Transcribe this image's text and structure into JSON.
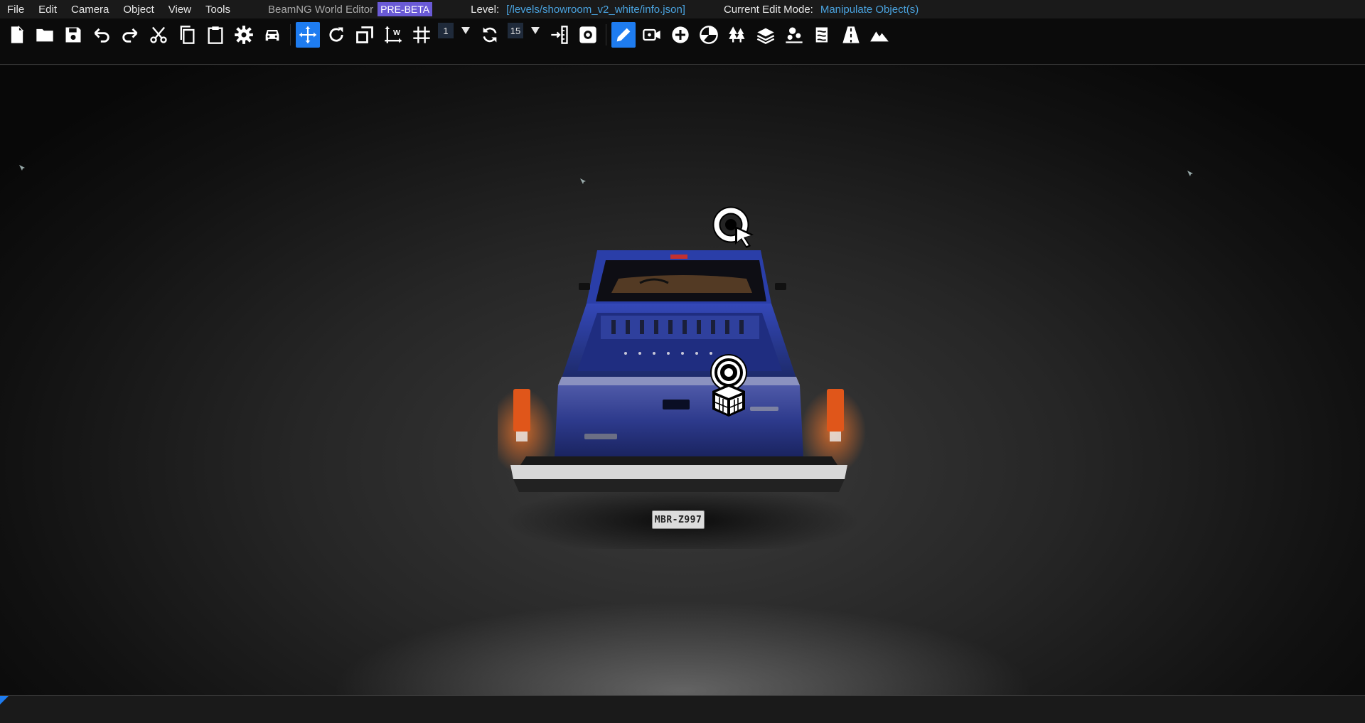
{
  "menu": {
    "items": [
      "File",
      "Edit",
      "Camera",
      "Object",
      "View",
      "Tools"
    ],
    "app_title": "BeamNG World Editor",
    "beta_badge": "PRE-BETA",
    "level_label": "Level:",
    "level_value": "[/levels/showroom_v2_white/info.json]",
    "mode_label": "Current Edit Mode:",
    "mode_value": "Manipulate Object(s)"
  },
  "toolbar": {
    "buttons": [
      "new-file-icon",
      "open-folder-icon",
      "save-icon",
      "undo-icon",
      "redo-icon",
      "cut-icon",
      "copy-icon",
      "paste-icon",
      "settings-gear-icon",
      "vehicle-icon",
      "translate-icon",
      "rotate-icon",
      "scale-icon",
      "world-space-icon",
      "grid-snap-icon",
      "rotation-snap-icon",
      "snap-to-terrain-icon",
      "preferences-icon",
      "edit-pencil-icon",
      "camera-path-icon",
      "create-object-icon",
      "decal-icon",
      "forest-icon",
      "terrain-material-icon",
      "object-placement-icon",
      "river-icon",
      "road-icon",
      "terrain-editor-icon"
    ],
    "grid_snap_value": "1",
    "rotation_snap_value": "15",
    "accent_color": "#1e7cf0"
  },
  "viewport": {
    "license_plate": "MBR-Z997",
    "vehicle_color": "#2a3d9a",
    "taillight_color": "#ff6a1a"
  },
  "colors": {
    "menu_bg": "#1a1a1a",
    "link_blue": "#4aa3df",
    "beta_purple": "#6a5ad6"
  }
}
